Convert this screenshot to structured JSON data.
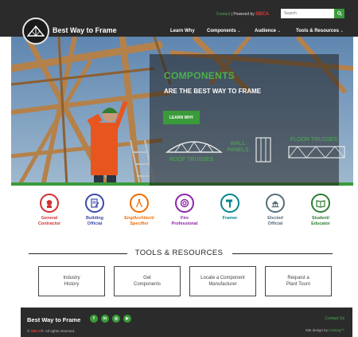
{
  "header": {
    "brand": "Best Way to Frame",
    "contact_label": "Contact",
    "separator": "|",
    "powered_by": "Powered by",
    "sbca": "SBCA",
    "search_placeholder": "Search",
    "nav": [
      {
        "label": "Learn Why",
        "chevron": ""
      },
      {
        "label": "Components",
        "chevron": "⌄"
      },
      {
        "label": "Audience",
        "chevron": "⌄"
      },
      {
        "label": "Tools & Resources",
        "chevron": "⌄"
      }
    ]
  },
  "hero": {
    "title": "COMPONENTS",
    "subtitle": "ARE THE BEST WAY TO FRAME",
    "button": "LEARN WHY",
    "labels": {
      "roof_trusses": "ROOF TRUSSES",
      "wall_panels_1": "WALL",
      "wall_panels_2": "PANELS",
      "floor_trusses": "FLOOR TRUSSES"
    }
  },
  "audience": [
    {
      "line1": "General",
      "line2": "Contractor",
      "color": "#d32f2f",
      "icon": "hardhat-person-icon"
    },
    {
      "line1": "Building",
      "line2": "Official",
      "color": "#3949ab",
      "icon": "document-pen-icon"
    },
    {
      "line1": "Eng/Architect/",
      "line2": "Specifier",
      "color": "#ef6c00",
      "icon": "compass-icon"
    },
    {
      "line1": "Fire",
      "line2": "Professional",
      "color": "#8e24aa",
      "icon": "lifebuoy-icon"
    },
    {
      "line1": "Framer",
      "line2": "",
      "color": "#00838f",
      "icon": "hammer-icon"
    },
    {
      "line1": "Elected",
      "line2": "Official",
      "color": "#546e7a",
      "icon": "capitol-icon"
    },
    {
      "line1": "Student/",
      "line2": "Educator",
      "color": "#2e7d32",
      "icon": "book-icon"
    }
  ],
  "tools": {
    "title": "TOOLS & RESOURCES",
    "items": [
      {
        "line1": "Industry",
        "line2": "History"
      },
      {
        "line1": "Get",
        "line2": "Components"
      },
      {
        "line1": "Locate a Component",
        "line2": "Manufacturer"
      },
      {
        "line1": "Request a",
        "line2": "Plant Tour¤"
      }
    ]
  },
  "footer": {
    "brand": "Best Way to Frame",
    "social": [
      "f",
      "in",
      "◎",
      "▶"
    ],
    "copyright_prefix": "©",
    "copyright_sbca": "SBCA",
    "copyright_suffix": "®. All rights reserved.",
    "contact": "Contact Us",
    "design_prefix": "Site design by",
    "design_by": "Hosting™"
  },
  "colors": {
    "accent": "#3a9b3a",
    "dark": "#2b2b2b",
    "sbca_red": "#e53935"
  }
}
